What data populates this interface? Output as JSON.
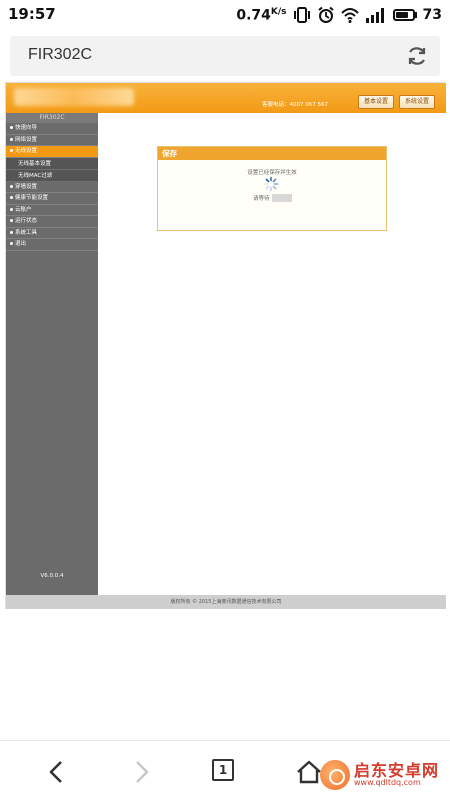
{
  "status_bar": {
    "time": "19:57",
    "net_speed": "0.74",
    "net_unit": "K/s",
    "battery_level": "73",
    "icons": [
      "vibrate-icon",
      "alarm-icon",
      "wifi-icon",
      "signal-icon",
      "battery-icon"
    ]
  },
  "browser": {
    "url_title": "FIR302C",
    "refresh_icon": "refresh-icon"
  },
  "router": {
    "header": {
      "phone": "客服电话：4007 067 567",
      "basic_settings": "基本设置",
      "system_settings": "系统设置"
    },
    "sidebar": {
      "title": "FIR302C",
      "items": [
        {
          "label": "快速向导",
          "active": false
        },
        {
          "label": "网络设置",
          "active": false
        },
        {
          "label": "无线设置",
          "active": true
        },
        {
          "label": "无线基本设置",
          "sub": true
        },
        {
          "label": "无线MAC过滤",
          "sub": true
        },
        {
          "label": "穿墙设置",
          "active": false
        },
        {
          "label": "健康节能设置",
          "active": false
        },
        {
          "label": "云账户",
          "active": false
        },
        {
          "label": "运行状态",
          "active": false
        },
        {
          "label": "系统工具",
          "active": false
        },
        {
          "label": "退出",
          "active": false
        }
      ],
      "version": "V6.0.0.4"
    },
    "save_dialog": {
      "title": "保存",
      "message": "设置已经保存并生效",
      "wait_label": "请等待"
    },
    "footer": "版权所有 © 2015上海斐讯数据通信技术有限公司"
  },
  "bottom_nav": {
    "back": "back-icon",
    "forward": "forward-icon",
    "tabs_count": "1",
    "home": "home-icon"
  },
  "watermark": {
    "name": "启东安卓网",
    "url": "www.qdltdq.com"
  },
  "colors": {
    "accent": "#f39a14",
    "sidebar": "#6b6b6b",
    "watermark": "#d33b2c"
  }
}
